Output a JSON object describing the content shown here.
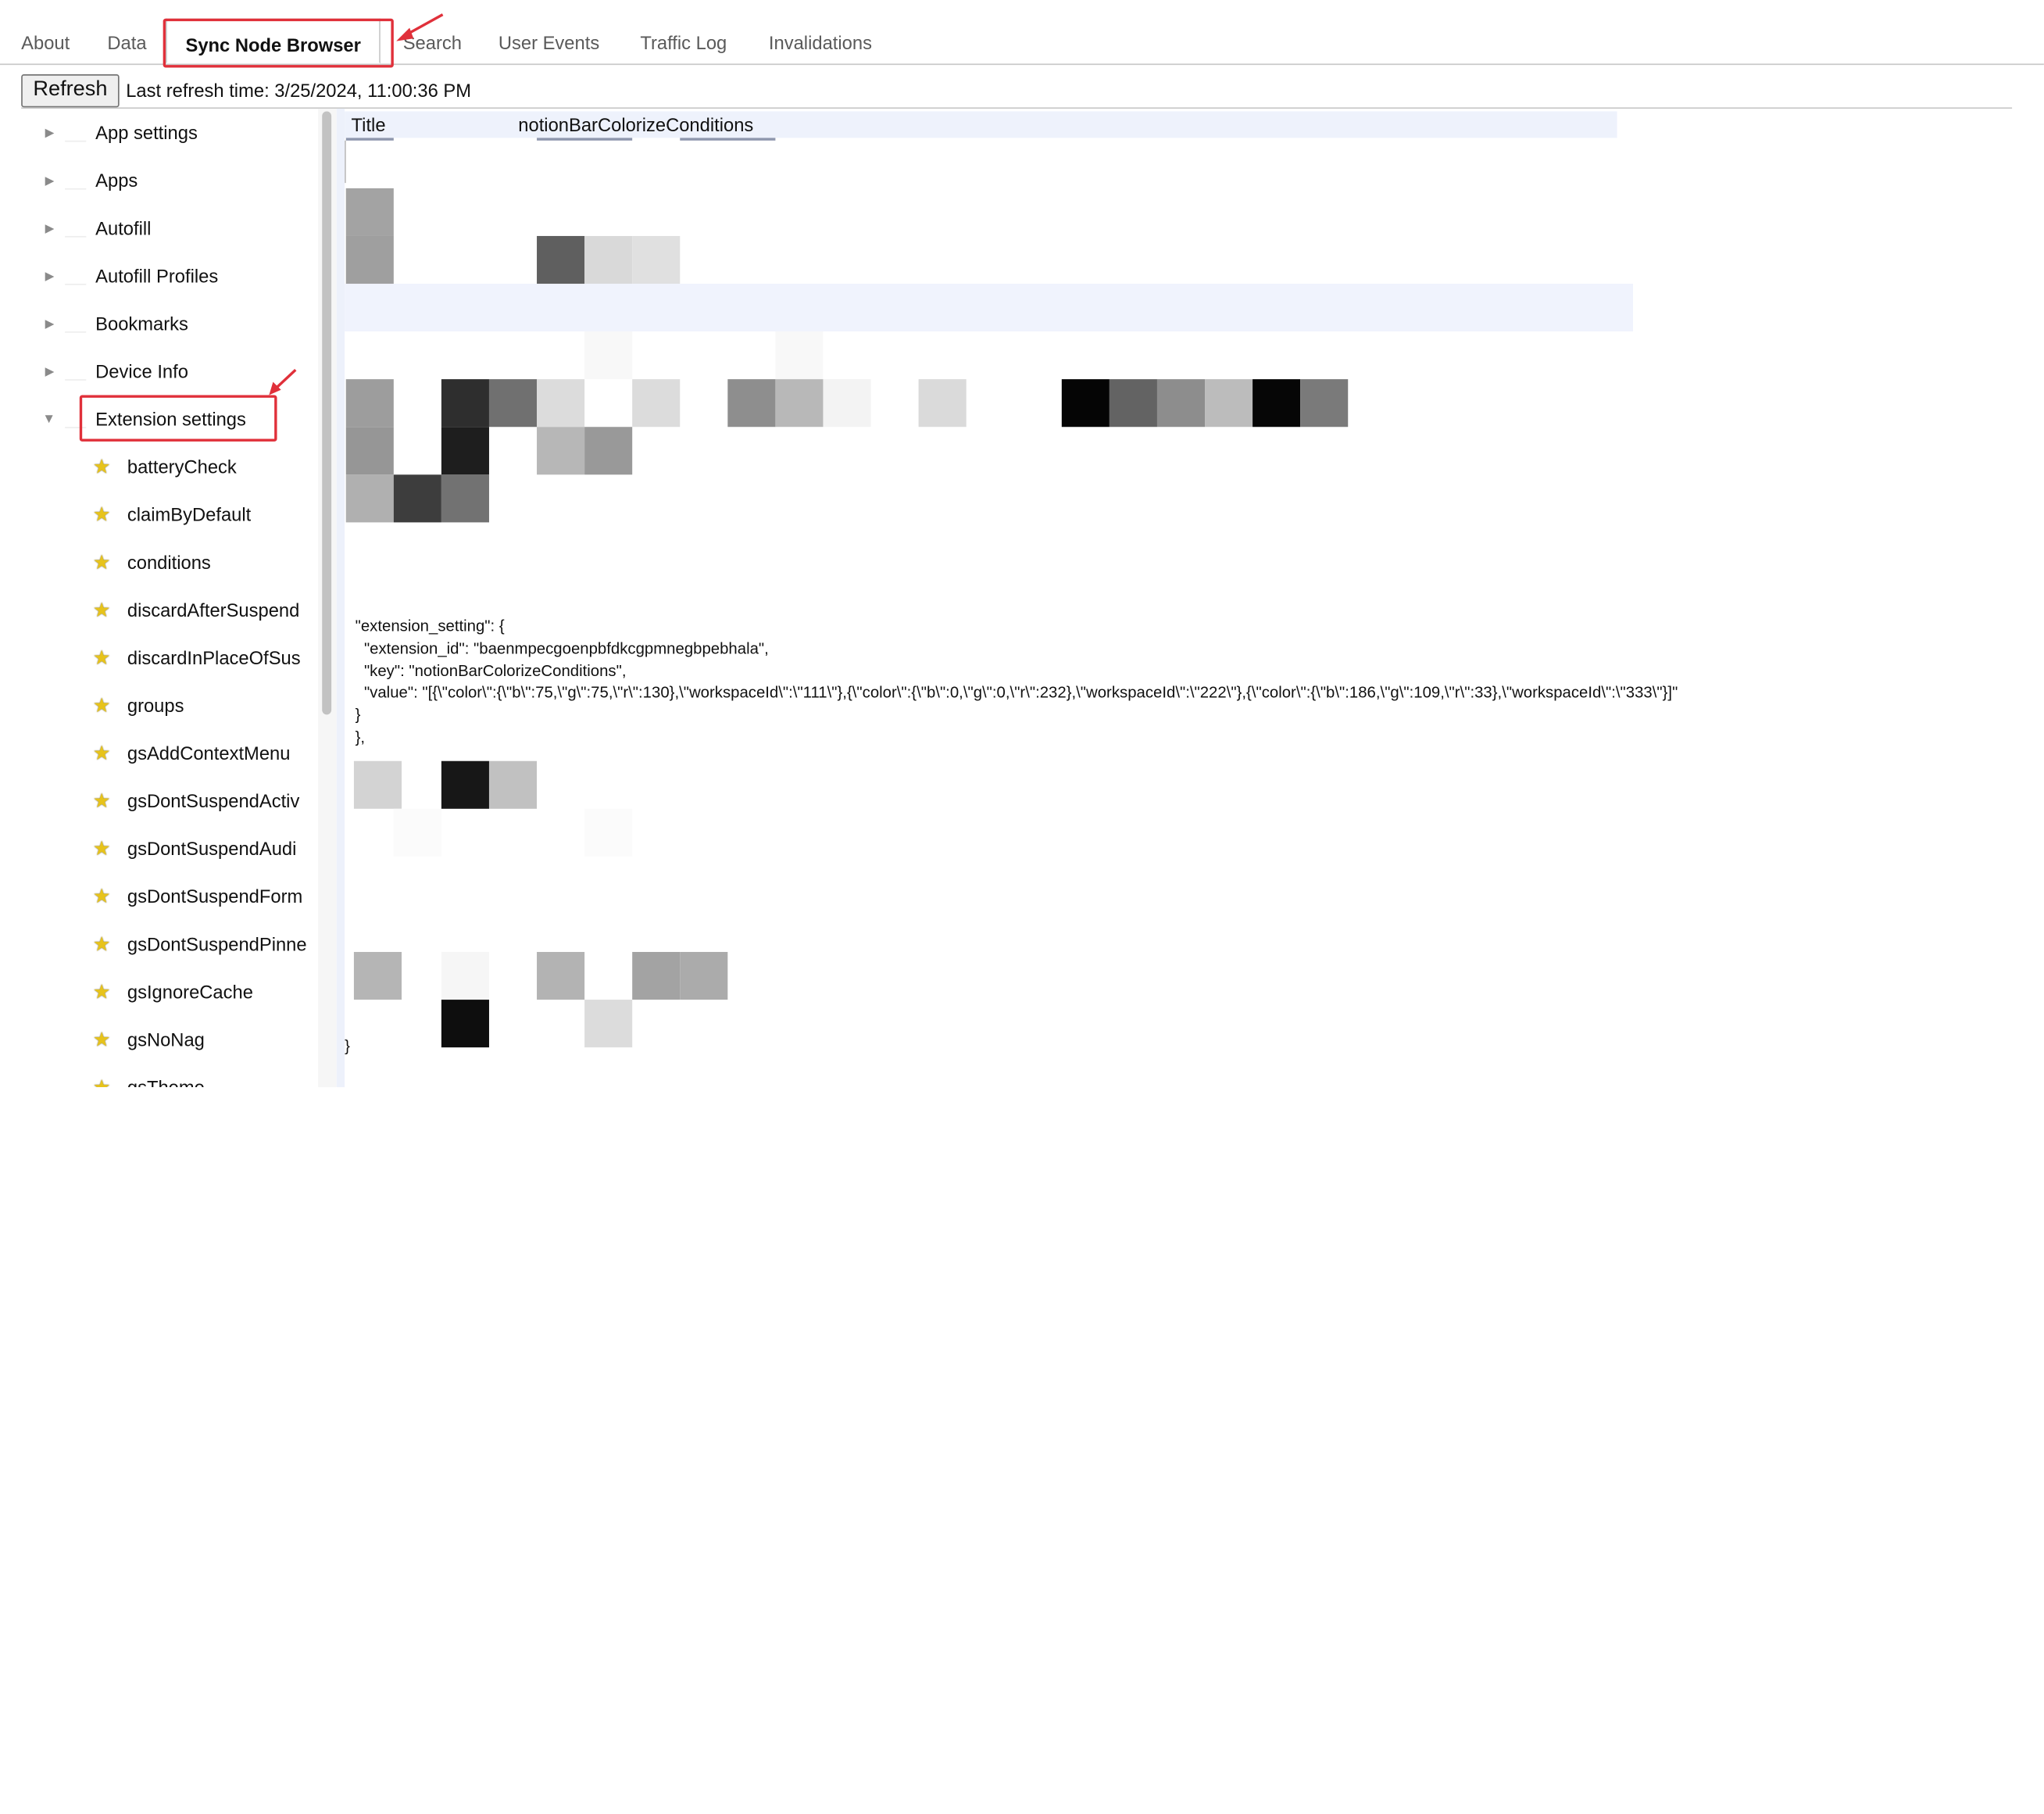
{
  "tabs": [
    {
      "label": "About",
      "active": false
    },
    {
      "label": "Data",
      "active": false
    },
    {
      "label": "Sync Node Browser",
      "active": true
    },
    {
      "label": "Search",
      "active": false
    },
    {
      "label": "User Events",
      "active": false
    },
    {
      "label": "Traffic Log",
      "active": false
    },
    {
      "label": "Invalidations",
      "active": false
    }
  ],
  "refresh": {
    "button_label": "Refresh",
    "status_text": "Last refresh time: 3/25/2024, 11:00:36 PM"
  },
  "tree": {
    "folders": [
      {
        "label": "App settings",
        "expanded": false
      },
      {
        "label": "Apps",
        "expanded": false
      },
      {
        "label": "Autofill",
        "expanded": false
      },
      {
        "label": "Autofill Profiles",
        "expanded": false
      },
      {
        "label": "Bookmarks",
        "expanded": false
      },
      {
        "label": "Device Info",
        "expanded": false
      },
      {
        "label": "Extension settings",
        "expanded": true
      }
    ],
    "leaves": [
      "batteryCheck",
      "claimByDefault",
      "conditions",
      "discardAfterSuspend",
      "discardInPlaceOfSus",
      "groups",
      "gsAddContextMenu",
      "gsDontSuspendActiv",
      "gsDontSuspendAudi",
      "gsDontSuspendForm",
      "gsDontSuspendPinne",
      "gsIgnoreCache",
      "gsNoNag",
      "gsTheme"
    ],
    "leaf_icon": "puzzle-star-icon"
  },
  "details": {
    "header_title": "Title",
    "header_value": "notionBarColorizeConditions",
    "json_lines": [
      "\"extension_setting\": {",
      "  \"extension_id\": \"baenmpecgoenpbfdkcgpmnegbpebhala\",",
      "  \"key\": \"notionBarColorizeConditions\",",
      "  \"value\": \"[{\\\"color\\\":{\\\"b\\\":75,\\\"g\\\":75,\\\"r\\\":130},\\\"workspaceId\\\":\\\"111\\\"},{\\\"color\\\":{\\\"b\\\":0,\\\"g\\\":0,\\\"r\\\":232},\\\"workspaceId\\\":\\\"222\\\"},{\\\"color\\\":{\\\"b\\\":186,\\\"g\\\":109,\\\"r\\\":33},\\\"workspaceId\\\":\\\"333\\\"}]\"",
      "}",
      "},"
    ],
    "closing_brace": "}"
  },
  "colors": {
    "highlight": "#e0303a",
    "header_bg": "#eef2fc",
    "stripe_bg": "#f0f3fd"
  }
}
